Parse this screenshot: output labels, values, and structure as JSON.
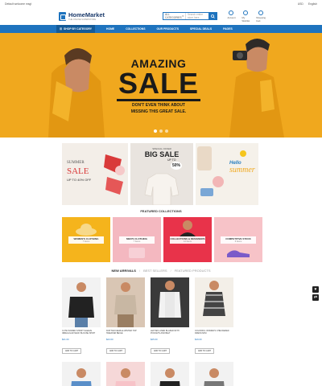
{
  "topbar": {
    "welcome": "Default welcome msg!",
    "currency": "USD",
    "language": "English"
  },
  "header": {
    "logo_name": "HomeMarket",
    "logo_tagline": "THE ONLINE SUPERSTORE",
    "search_category": "ALL CATEGORIES",
    "search_placeholder": "Search entire store here...",
    "icons": [
      {
        "label": "Account",
        "icon": "user-icon"
      },
      {
        "label": "My Wishlist",
        "icon": "heart-icon"
      },
      {
        "label": "Shopping Cart",
        "icon": "cart-icon"
      }
    ]
  },
  "nav": {
    "categories_label": "SHOP BY CATEGORY",
    "items": [
      "HOME",
      "COLLECTIONS",
      "OUR PRODUCTS",
      "SPECIAL DEALS",
      "PAGES"
    ]
  },
  "hero": {
    "headline": "AMAZING",
    "title": "SALE",
    "subtitle_line1": "DON'T EVEN THINK ABOUT",
    "subtitle_line2": "MISSING THIS GREAT SALE."
  },
  "banners": {
    "summer": {
      "line1": "SUMMER",
      "line2": "SALE",
      "line3": "UP TO 40% OFF"
    },
    "big_sale": {
      "line1": "SPECIAL OFFER",
      "line2": "BIG SALE",
      "line3": "UP TO",
      "line4": "50%"
    },
    "hello_summer": {
      "line1": "Hello",
      "line2": "summer"
    }
  },
  "featured_title": "FEATURED COLLECTIONS",
  "collections": [
    {
      "name": "WOMEN'S CLOTHING",
      "count": "7 Items",
      "color": "#f5b41c"
    },
    {
      "name": "MEN'S CLOTHING",
      "count": "7 Items",
      "color": "#f4b8c0"
    },
    {
      "name": "COLLECTIONS & DESIGNERS",
      "count": "12 Items",
      "color": "#e8334a"
    },
    {
      "name": "COMPETITIVE STOCK",
      "count": "6 Items",
      "color": "#f7c3c8"
    }
  ],
  "tabs": [
    "NEW ARRIVALS",
    "BEST SELLERS",
    "FEATURED PRODUCTS"
  ],
  "products": [
    {
      "name": "CUTE WOMEN SHORT SLEEVE IRREGULAR NECK BLOUSE SHIRT",
      "price": "$21.00",
      "button": "ADD TO CART"
    },
    {
      "name": "KNITTED FEMALE WINTER TOP SWEATER BEIGE",
      "price": "$23.00",
      "button": "ADD TO CART"
    },
    {
      "name": "LEFTIES LINEN BLAZER WITH POCKETS AND BELT",
      "price": "$25.00",
      "button": "ADD TO CART"
    },
    {
      "name": "COLORFUL WOMEN'S CHECKERED DRESS MINI",
      "price": "$19.00",
      "button": "ADD TO CART"
    }
  ],
  "side_buttons": [
    "heart-icon",
    "compare-icon"
  ]
}
